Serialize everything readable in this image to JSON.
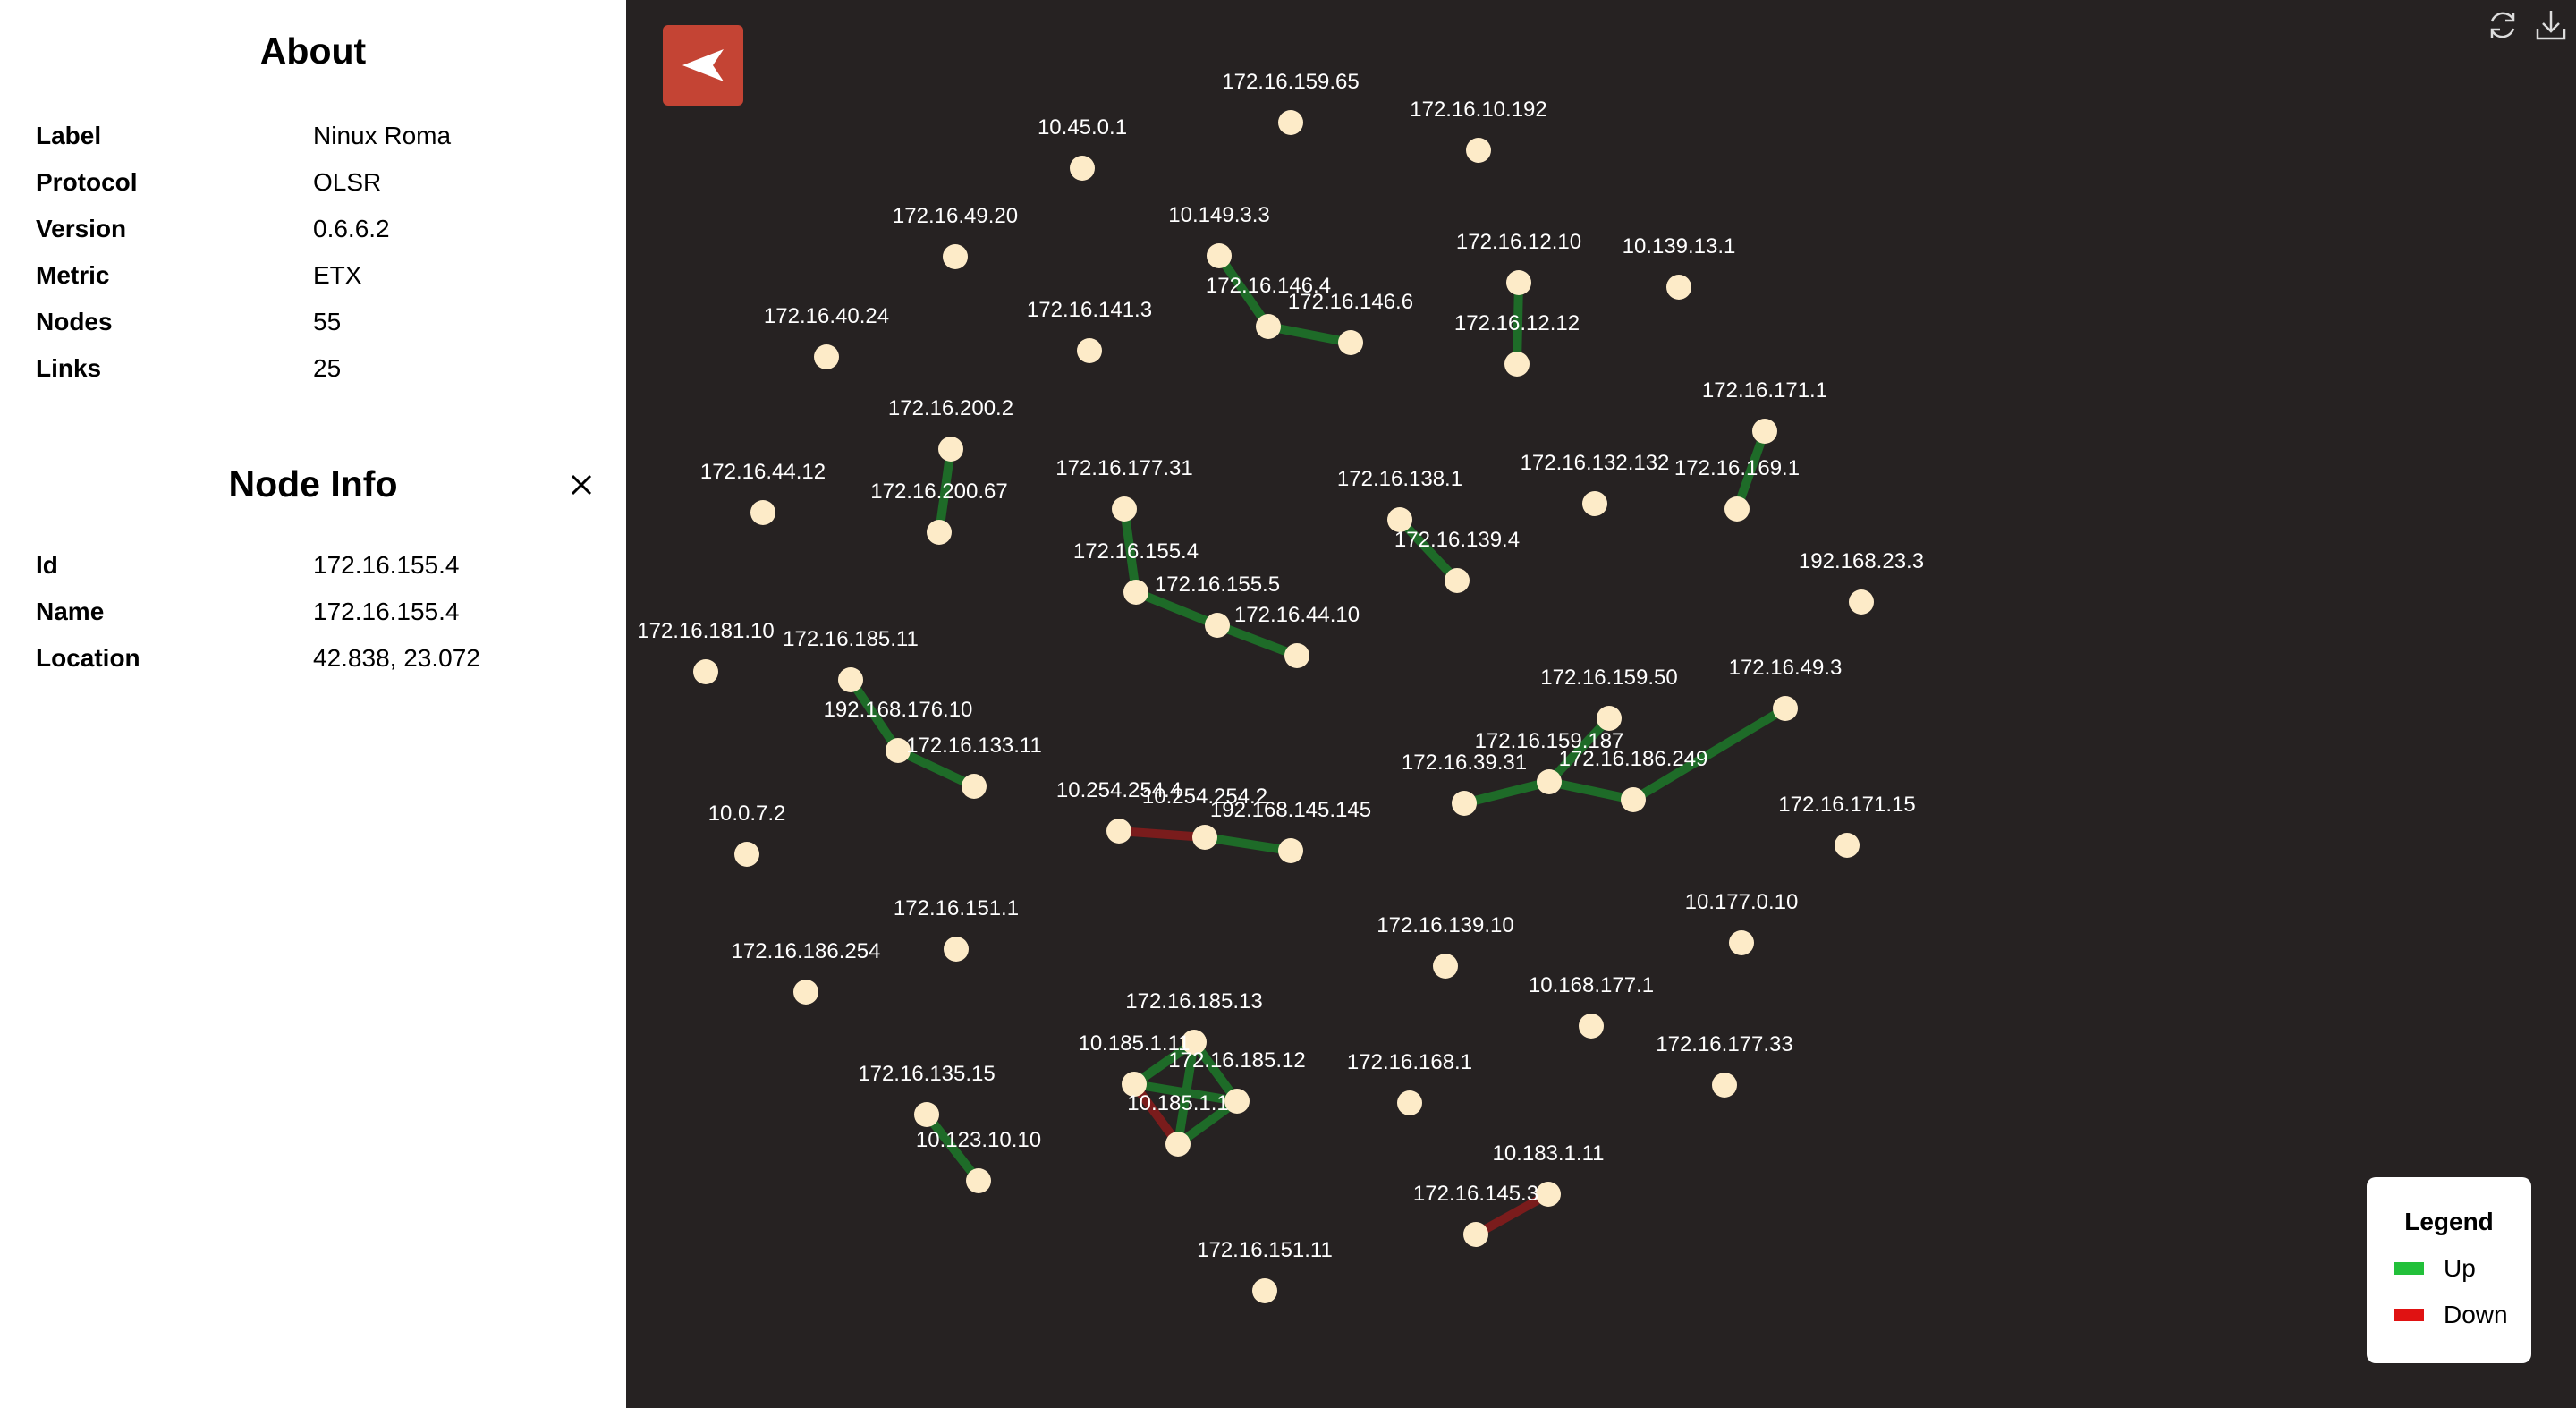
{
  "about": {
    "title": "About",
    "rows": [
      {
        "key": "Label",
        "value": "Ninux Roma"
      },
      {
        "key": "Protocol",
        "value": "OLSR"
      },
      {
        "key": "Version",
        "value": "0.6.6.2"
      },
      {
        "key": "Metric",
        "value": "ETX"
      },
      {
        "key": "Nodes",
        "value": "55"
      },
      {
        "key": "Links",
        "value": "25"
      }
    ]
  },
  "node_info": {
    "title": "Node Info",
    "close_icon": "close-icon",
    "rows": [
      {
        "key": "Id",
        "value": "172.16.155.4"
      },
      {
        "key": "Name",
        "value": "172.16.155.4"
      },
      {
        "key": "Location",
        "value": "42.838, 23.072"
      }
    ]
  },
  "toolbar": {
    "back_icon": "navigate-arrow-icon",
    "refresh_icon": "refresh-icon",
    "download_icon": "download-icon"
  },
  "legend": {
    "title": "Legend",
    "items": [
      {
        "label": "Up",
        "color": "#22c03a"
      },
      {
        "label": "Down",
        "color": "#e01212"
      }
    ]
  },
  "colors": {
    "background": "#262222",
    "node": "#fdebc8",
    "label": "#ffffff",
    "link_up": "#1e6b28",
    "link_down": "#7a1c1c",
    "accent": "#c44434"
  },
  "nodes": [
    {
      "id": "10.45.0.1"
    },
    {
      "id": "172.16.159.65"
    },
    {
      "id": "172.16.10.192"
    },
    {
      "id": "172.16.49.20"
    },
    {
      "id": "10.149.3.3"
    },
    {
      "id": "172.16.12.10"
    },
    {
      "id": "10.139.13.1"
    },
    {
      "id": "172.16.146.4"
    },
    {
      "id": "172.16.146.6"
    },
    {
      "id": "172.16.40.24"
    },
    {
      "id": "172.16.141.3"
    },
    {
      "id": "172.16.12.12"
    },
    {
      "id": "172.16.171.1"
    },
    {
      "id": "172.16.200.2"
    },
    {
      "id": "172.16.44.12"
    },
    {
      "id": "172.16.200.67"
    },
    {
      "id": "172.16.177.31"
    },
    {
      "id": "172.16.138.1"
    },
    {
      "id": "172.16.132.132"
    },
    {
      "id": "172.16.169.1"
    },
    {
      "id": "172.16.155.4"
    },
    {
      "id": "172.16.139.4"
    },
    {
      "id": "172.16.155.5"
    },
    {
      "id": "192.168.23.3"
    },
    {
      "id": "172.16.181.10"
    },
    {
      "id": "172.16.185.11"
    },
    {
      "id": "172.16.44.10"
    },
    {
      "id": "192.168.176.10"
    },
    {
      "id": "172.16.133.11"
    },
    {
      "id": "172.16.159.50"
    },
    {
      "id": "172.16.49.3"
    },
    {
      "id": "172.16.159.187"
    },
    {
      "id": "172.16.39.31"
    },
    {
      "id": "172.16.186.249"
    },
    {
      "id": "10.254.254.4"
    },
    {
      "id": "10.254.254.2"
    },
    {
      "id": "192.168.145.145"
    },
    {
      "id": "10.0.7.2"
    },
    {
      "id": "172.16.171.15"
    },
    {
      "id": "172.16.151.1"
    },
    {
      "id": "10.177.0.10"
    },
    {
      "id": "172.16.139.10"
    },
    {
      "id": "172.16.186.254"
    },
    {
      "id": "10.168.177.1"
    },
    {
      "id": "172.16.185.13"
    },
    {
      "id": "10.185.1.11"
    },
    {
      "id": "172.16.185.12"
    },
    {
      "id": "172.16.168.1"
    },
    {
      "id": "172.16.177.33"
    },
    {
      "id": "172.16.135.15"
    },
    {
      "id": "10.185.1.1"
    },
    {
      "id": "10.123.10.10"
    },
    {
      "id": "10.183.1.11"
    },
    {
      "id": "172.16.145.3"
    },
    {
      "id": "172.16.151.11"
    }
  ],
  "links": [
    {
      "source": "10.149.3.3",
      "target": "172.16.146.4",
      "status": "up"
    },
    {
      "source": "172.16.146.4",
      "target": "172.16.146.6",
      "status": "up"
    },
    {
      "source": "172.16.12.10",
      "target": "172.16.12.12",
      "status": "up"
    },
    {
      "source": "172.16.171.1",
      "target": "172.16.169.1",
      "status": "up"
    },
    {
      "source": "172.16.200.2",
      "target": "172.16.200.67",
      "status": "up"
    },
    {
      "source": "172.16.177.31",
      "target": "172.16.155.4",
      "status": "up"
    },
    {
      "source": "172.16.155.4",
      "target": "172.16.155.5",
      "status": "up"
    },
    {
      "source": "172.16.155.5",
      "target": "172.16.44.10",
      "status": "up"
    },
    {
      "source": "172.16.138.1",
      "target": "172.16.139.4",
      "status": "up"
    },
    {
      "source": "172.16.185.11",
      "target": "192.168.176.10",
      "status": "up"
    },
    {
      "source": "192.168.176.10",
      "target": "172.16.133.11",
      "status": "up"
    },
    {
      "source": "172.16.159.50",
      "target": "172.16.159.187",
      "status": "up"
    },
    {
      "source": "172.16.159.187",
      "target": "172.16.39.31",
      "status": "up"
    },
    {
      "source": "172.16.159.187",
      "target": "172.16.186.249",
      "status": "up"
    },
    {
      "source": "172.16.49.3",
      "target": "172.16.186.249",
      "status": "up"
    },
    {
      "source": "10.254.254.4",
      "target": "10.254.254.2",
      "status": "down"
    },
    {
      "source": "10.254.254.2",
      "target": "192.168.145.145",
      "status": "up"
    },
    {
      "source": "10.185.1.11",
      "target": "172.16.185.13",
      "status": "up"
    },
    {
      "source": "10.185.1.11",
      "target": "172.16.185.12",
      "status": "up"
    },
    {
      "source": "172.16.185.13",
      "target": "172.16.185.12",
      "status": "up"
    },
    {
      "source": "172.16.185.13",
      "target": "10.185.1.1",
      "status": "up"
    },
    {
      "source": "172.16.185.12",
      "target": "10.185.1.1",
      "status": "up"
    },
    {
      "source": "10.185.1.11",
      "target": "10.185.1.1",
      "status": "down"
    },
    {
      "source": "172.16.135.15",
      "target": "10.123.10.10",
      "status": "up"
    },
    {
      "source": "10.183.1.11",
      "target": "172.16.145.3",
      "status": "down"
    }
  ]
}
